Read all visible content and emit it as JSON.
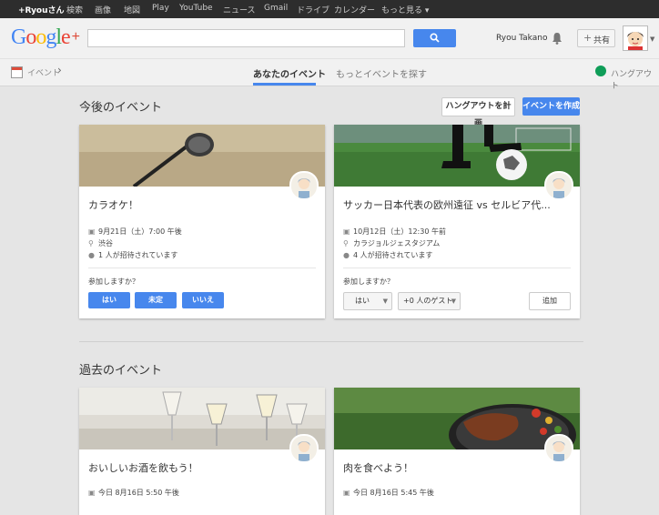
{
  "topbar": {
    "items": [
      "+Ryouさん",
      "検索",
      "画像",
      "地図",
      "Play",
      "YouTube",
      "ニュース",
      "Gmail",
      "ドライブ",
      "カレンダー",
      "もっと見る ▾"
    ]
  },
  "header": {
    "logo_text": "Google",
    "logo_plus": "+",
    "search_value": "",
    "user_name": "Ryou Takano",
    "share_plus": "+",
    "share_label": "共有"
  },
  "subnav": {
    "events_label": "イベント",
    "tab_active": "あなたのイベント",
    "tab_find": "もっとイベントを探す",
    "hangouts_label": "ハングアウト"
  },
  "upcoming": {
    "title": "今後のイベント",
    "plan_button": "ハングアウトを計画",
    "create_button": "イベントを作成",
    "cards": [
      {
        "title": "カラオケ！",
        "date": "9月21日（土）7:00 午後",
        "place": "渋谷",
        "invited": "1 人が招待されています",
        "question": "参加しますか？",
        "yes": "はい",
        "maybe": "未定",
        "no": "いいえ"
      },
      {
        "title": "サッカー日本代表の欧州遠征 vs セルビア代...",
        "date": "10月12日（土）12:30 午前",
        "place": "カラジョルジェスタジアム",
        "invited": "4 人が招待されています",
        "question": "参加しますか？",
        "rsvp_value": "はい",
        "guests_value": "+0 人のゲスト",
        "add": "追加"
      }
    ]
  },
  "past": {
    "title": "過去のイベント",
    "cards": [
      {
        "title": "おいしいお酒を飲もう！",
        "date": "今日 8月16日 5:50 午後"
      },
      {
        "title": "肉を食べよう！",
        "date": "今日 8月16日 5:45 午後"
      }
    ]
  },
  "colors": {
    "accent": "#4787ed",
    "topbar": "#2d2d2d",
    "background": "#e5e5e5"
  }
}
